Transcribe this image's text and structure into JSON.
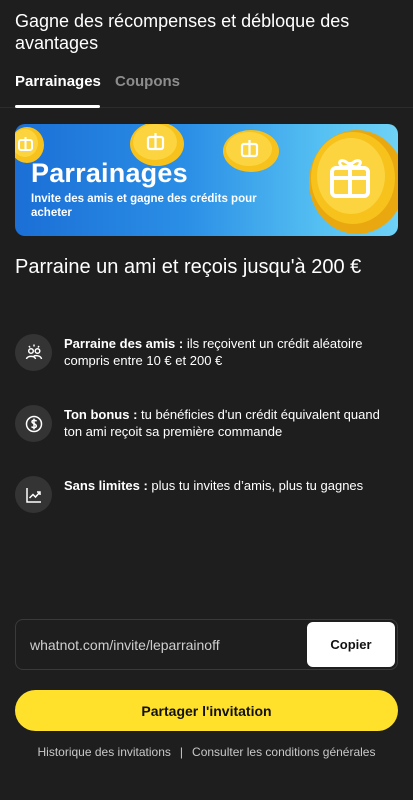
{
  "header": {
    "title": "Gagne des récompenses et débloque des avantages"
  },
  "tabs": [
    {
      "label": "Parrainages",
      "active": true
    },
    {
      "label": "Coupons",
      "active": false
    }
  ],
  "banner": {
    "title": "Parrainages",
    "subtitle": "Invite des amis et gagne des crédits pour acheter",
    "icon": "gift-coin-icon"
  },
  "headline": "Parraine un ami et reçois jusqu'à 200 €",
  "features": [
    {
      "icon": "people-sparkle-icon",
      "bold": "Parraine des amis :",
      "text": " ils reçoivent un crédit aléatoire compris entre 10 € et 200 €"
    },
    {
      "icon": "dollar-coin-icon",
      "bold": "Ton bonus :",
      "text": " tu bénéficies d'un crédit équivalent quand ton ami reçoit sa première commande"
    },
    {
      "icon": "trending-up-icon",
      "bold": "Sans limites :",
      "text": " plus tu invites d’amis, plus tu gagnes"
    }
  ],
  "invite": {
    "url": "whatnot.com/invite/leparrainoff",
    "copy_label": "Copier"
  },
  "share_label": "Partager l'invitation",
  "footer": {
    "history_link": "Historique des invitations",
    "separator": "|",
    "terms_link": "Consulter les conditions générales"
  },
  "colors": {
    "background": "#1e1e1e",
    "accent_yellow": "#ffe12b",
    "banner_blue": "#1b6fd6",
    "coin_gold": "#f7c21b"
  }
}
